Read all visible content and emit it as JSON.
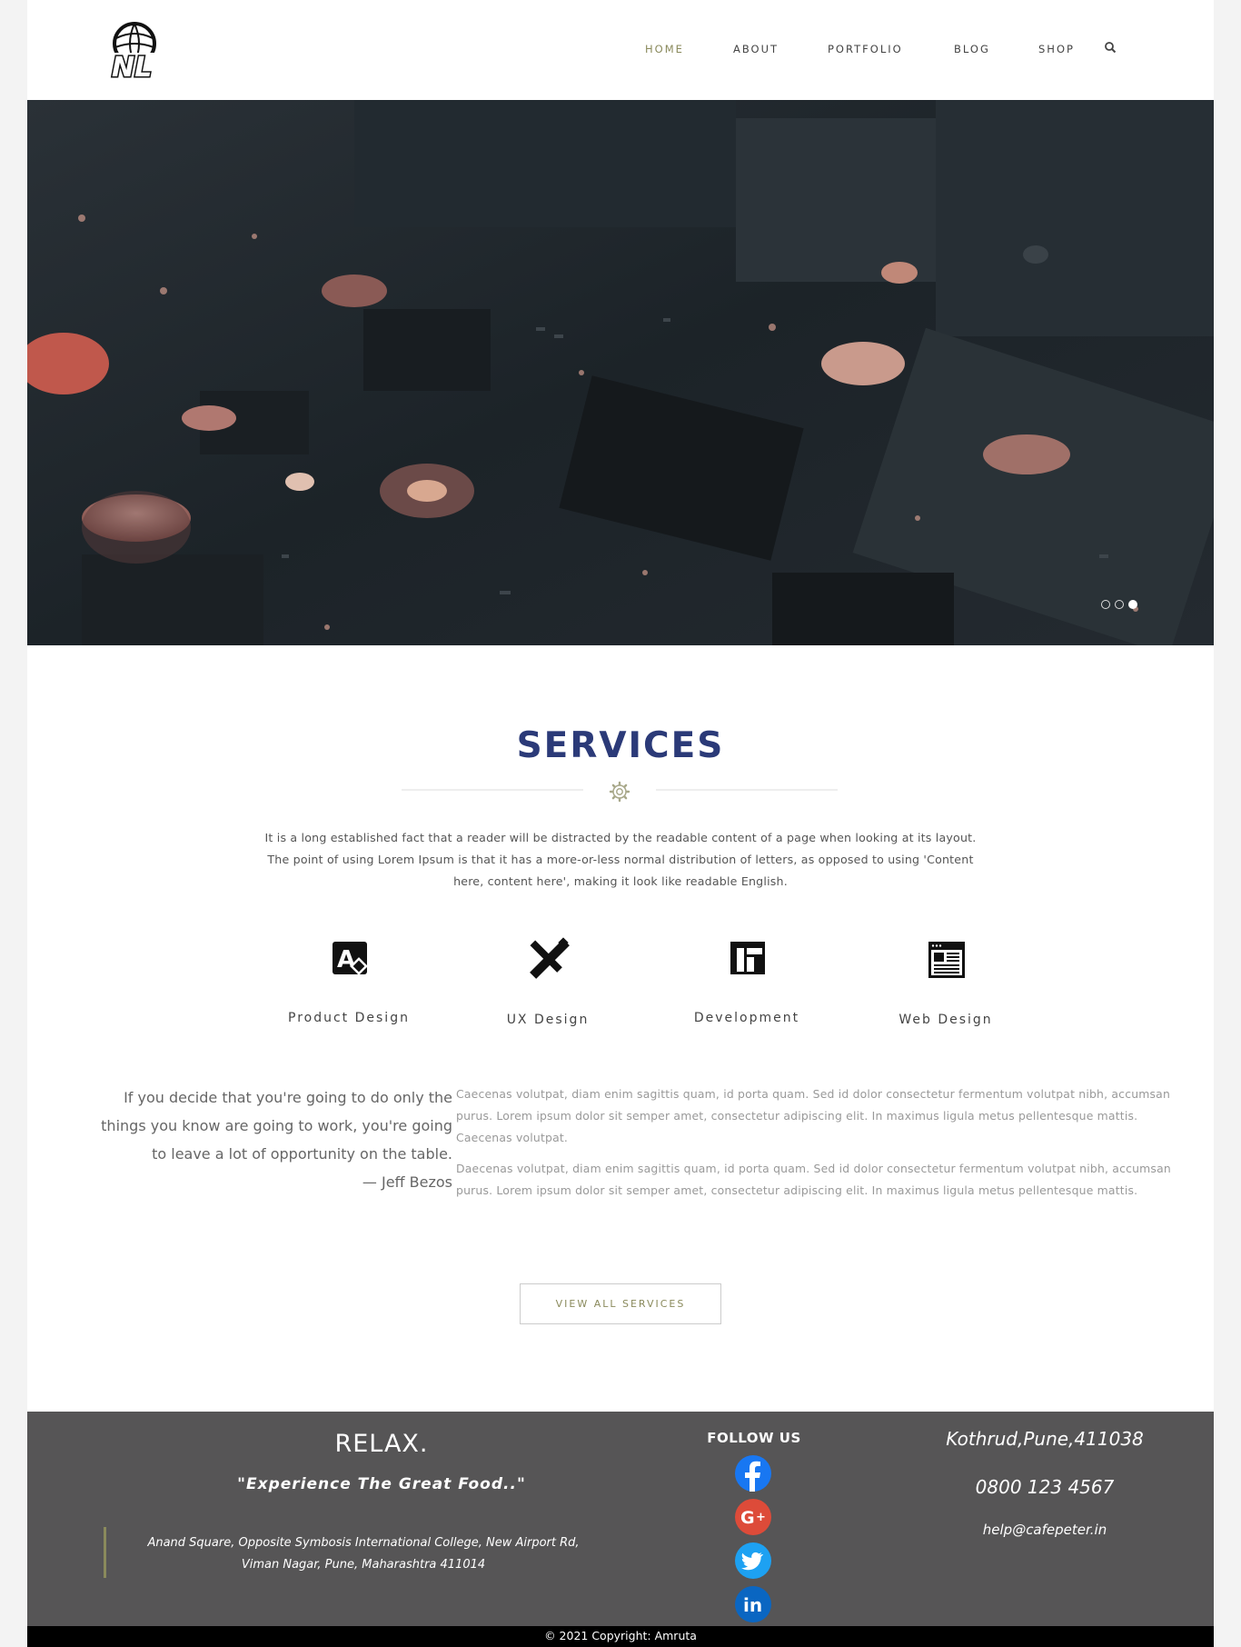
{
  "header": {
    "logo_text": "NL",
    "nav": [
      {
        "label": "HOME",
        "active": true
      },
      {
        "label": "ABOUT",
        "active": false
      },
      {
        "label": "PORTFOLIO",
        "active": false
      },
      {
        "label": "BLOG",
        "active": false
      },
      {
        "label": "SHOP",
        "active": false
      }
    ],
    "search_icon": "search-icon"
  },
  "hero": {
    "image": "circuit-board-photo",
    "slides": 3,
    "active_slide": 3
  },
  "services": {
    "title": "SERVICES",
    "intro": "It is a long established fact that a reader will be distracted by the readable content of a page when looking at its layout. The point of using Lorem Ipsum is that it has a more-or-less normal distribution of letters, as opposed to using 'Content here, content here', making it look like readable English.",
    "items": [
      {
        "label": "Product Design",
        "icon": "product-design-icon"
      },
      {
        "label": "UX Design",
        "icon": "ux-design-icon"
      },
      {
        "label": "Development",
        "icon": "development-icon"
      },
      {
        "label": "Web Design",
        "icon": "web-design-icon"
      }
    ],
    "quote": "If you decide that you're going to do only the things you know are going to work, you're going to leave a lot of opportunity on the table.",
    "quote_author": "— Jeff Bezos",
    "paragraphs": [
      "Caecenas volutpat, diam enim sagittis quam, id porta quam. Sed id dolor consectetur fermentum volutpat nibh, accumsan purus. Lorem ipsum dolor sit semper amet, consectetur adipiscing elit. In maximus ligula metus pellentesque mattis. Caecenas volutpat.",
      "Daecenas volutpat, diam enim sagittis quam, id porta quam. Sed id dolor consectetur fermentum volutpat nibh, accumsan purus. Lorem ipsum dolor sit semper amet, consectetur adipiscing elit. In maximus ligula metus pellentesque mattis."
    ],
    "button_label": "VIEW ALL SERVICES"
  },
  "footer": {
    "heading": "RELAX.",
    "tagline": "\"Experience The Great Food..\"",
    "address_line1": "Anand Square, Opposite Symbosis International College, New Airport Rd,",
    "address_line2": "Viman Nagar, Pune, Maharashtra 411014",
    "follow_label": "FOLLOW US",
    "social": [
      {
        "name": "facebook",
        "icon": "facebook-icon",
        "color": "#1877f2"
      },
      {
        "name": "google-plus",
        "icon": "google-plus-icon",
        "color": "#dd4b39"
      },
      {
        "name": "twitter",
        "icon": "twitter-icon",
        "color": "#1da1f2"
      },
      {
        "name": "linkedin",
        "icon": "linkedin-icon",
        "color": "#0a66c2"
      }
    ],
    "location": "Kothrud,Pune,411038",
    "phone": "0800 123 4567",
    "email": "help@cafepeter.in",
    "copyright": "© 2021 Copyright: Amruta"
  },
  "colors": {
    "accent": "#8a8a5c",
    "title_blue": "#2b3a78",
    "footer_bg": "#565556"
  }
}
